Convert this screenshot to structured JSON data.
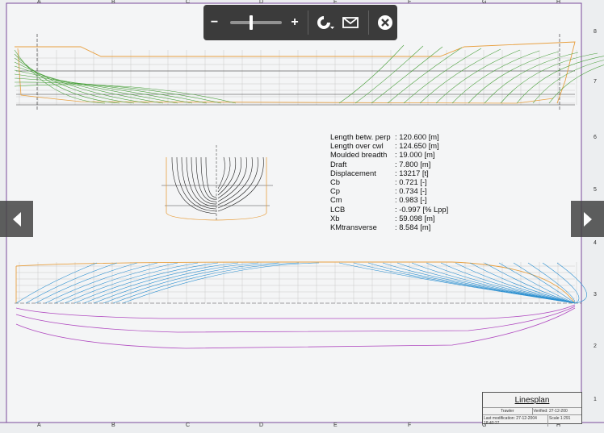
{
  "grid": {
    "columns": [
      "A",
      "B",
      "C",
      "D",
      "E",
      "F",
      "G",
      "H"
    ],
    "rows": [
      "8",
      "7",
      "6",
      "5",
      "4",
      "3",
      "2",
      "1"
    ]
  },
  "toolbar": {
    "zoom_out_label": "−",
    "zoom_in_label": "+",
    "zoom_level": 0.38,
    "icons": [
      "zoom-out-icon",
      "zoom-in-icon",
      "refresh-icon",
      "mail-icon",
      "close-icon"
    ]
  },
  "hydrostatics": [
    {
      "label": "Length betw. perp",
      "value": ": 120.600 [m]"
    },
    {
      "label": "Length over cwl",
      "value": ": 124.650 [m]"
    },
    {
      "label": "Moulded breadth",
      "value": ": 19.000 [m]"
    },
    {
      "label": "Draft",
      "value": ": 7.800 [m]"
    },
    {
      "label": "Displacement",
      "value": ": 13217 [t]"
    },
    {
      "label": "Cb",
      "value": ": 0.721 [-]"
    },
    {
      "label": "Cp",
      "value": ": 0.734 [-]"
    },
    {
      "label": "Cm",
      "value": ": 0.983 [-]"
    },
    {
      "label": "LCB",
      "value": ": -0.997 [% Lpp]"
    },
    {
      "label": "Xb",
      "value": ": 59.098 [m]"
    },
    {
      "label": "KMtransverse",
      "value": ": 8.584 [m]"
    }
  ],
  "title_block": {
    "title": "Linesplan",
    "subtitle": "Trawler",
    "verified": "Verified: 27-12-200",
    "last_modification": "Last modification: 27-12-2004 18:40:27",
    "scale": "Scale 1:291"
  },
  "colors": {
    "profile_lines": "#4aa03c",
    "plan_lines": "#2a8fd0",
    "outline": "#e8a040",
    "buttocks": "#b04ac0",
    "frame": "#8a4aa8"
  }
}
